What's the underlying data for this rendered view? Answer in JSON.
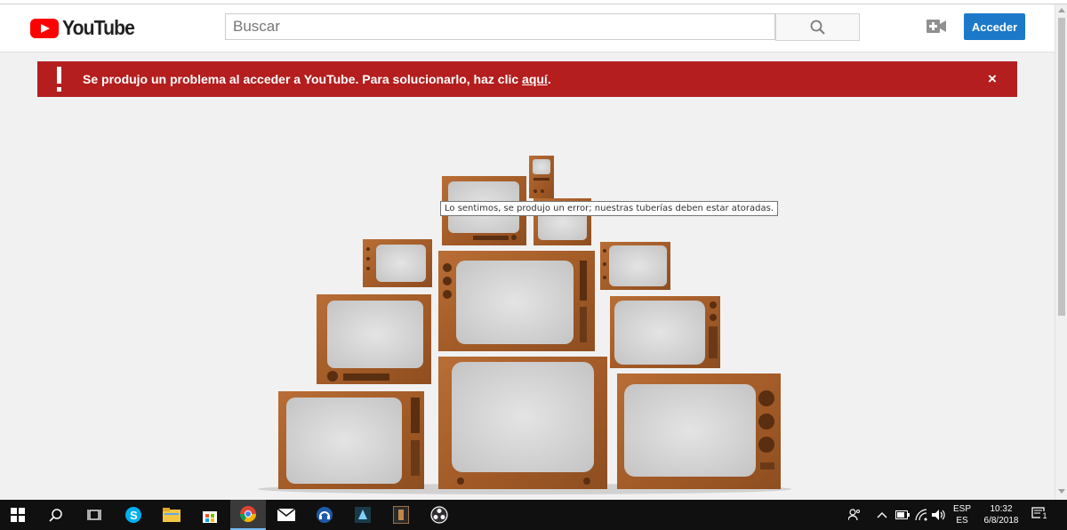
{
  "header": {
    "logo_text": "YouTube",
    "search_placeholder": "Buscar",
    "signin_label": "Acceder",
    "icons": [
      "search-icon",
      "video-camera-plus-icon"
    ],
    "accent_color": "#1c79c9"
  },
  "alert": {
    "message": "Se produjo un problema al acceder a YouTube. Para solucionarlo, haz clic ",
    "link_text": "aquí",
    "suffix": ".",
    "close_symbol": "×",
    "background_color": "#b41e1e"
  },
  "tooltip": {
    "text": "Lo sentimos, se produjo un error; nuestras tuberías deben estar atoradas."
  },
  "taskbar": {
    "apps": [
      "windows-start-icon",
      "search-icon",
      "task-view-icon",
      "skype-icon",
      "file-explorer-icon",
      "store-icon",
      "chrome-icon",
      "mail-icon",
      "headset-app-icon",
      "app-icon",
      "video-app-icon",
      "obs-icon"
    ],
    "language_top": "ESP",
    "language_bottom": "ES",
    "time": "10:32",
    "date": "6/8/2018",
    "notification_count": "1"
  }
}
